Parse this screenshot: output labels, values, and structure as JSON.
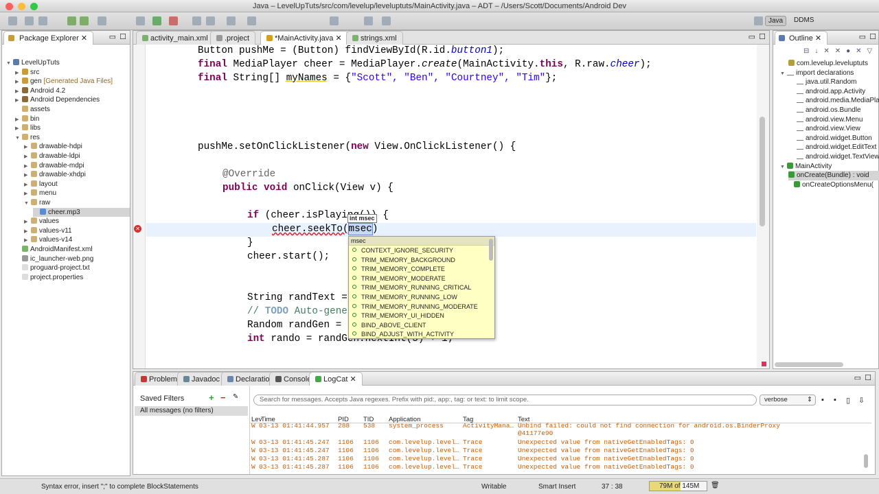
{
  "window": {
    "title": "Java – LevelUpTuts/src/com/levelup/leveluptuts/MainActivity.java – ADT – /Users/Scott/Documents/Android Dev"
  },
  "perspectives": {
    "java": "Java",
    "ddms": "DDMS"
  },
  "package_explorer": {
    "title": "Package Explorer",
    "items": [
      {
        "label": "LevelUpTuts"
      },
      {
        "label": "src"
      },
      {
        "label": "gen",
        "suffix": "[Generated Java Files]"
      },
      {
        "label": "Android 4.2"
      },
      {
        "label": "Android Dependencies"
      },
      {
        "label": "assets"
      },
      {
        "label": "bin"
      },
      {
        "label": "libs"
      },
      {
        "label": "res"
      },
      {
        "label": "drawable-hdpi"
      },
      {
        "label": "drawable-ldpi"
      },
      {
        "label": "drawable-mdpi"
      },
      {
        "label": "drawable-xhdpi"
      },
      {
        "label": "layout"
      },
      {
        "label": "menu"
      },
      {
        "label": "raw"
      },
      {
        "label": "cheer.mp3"
      },
      {
        "label": "values"
      },
      {
        "label": "values-v11"
      },
      {
        "label": "values-v14"
      },
      {
        "label": "AndroidManifest.xml"
      },
      {
        "label": "ic_launcher-web.png"
      },
      {
        "label": "proguard-project.txt"
      },
      {
        "label": "project.properties"
      }
    ]
  },
  "editor": {
    "tabs": [
      {
        "label": "activity_main.xml"
      },
      {
        "label": ".project"
      },
      {
        "label": "*MainActivity.java"
      },
      {
        "label": "strings.xml"
      }
    ],
    "code": {
      "l1a": "Button pushMe = (Button) findViewById(R.id.",
      "l1b": "button1",
      "l1c": ");",
      "l2a": "final",
      "l2b": " MediaPlayer cheer = MediaPlayer.",
      "l2c": "create",
      "l2d": "(MainActivity.",
      "l2e": "this",
      "l2f": ", R.raw.",
      "l2g": "cheer",
      "l2h": ");",
      "l3a": "final",
      "l3b": " String[] ",
      "l3c": "myNames",
      "l3d": " = {",
      "l3e": "\"Scott\", \"Ben\", \"Courtney\", \"Tim\"",
      "l3f": "};",
      "l4a": "pushMe.setOnClickListener(",
      "l4b": "new",
      "l4c": " View.OnClickListener() {",
      "l5": "@Override",
      "l6a": "public void",
      "l6b": " onClick(View v) {",
      "l7a": "if",
      "l7b": " (cheer.isPlaying()) {",
      "l8a": "cheer.seekTo(",
      "l8b": "msec",
      "l8c": ")",
      "l9": "}",
      "l10": "cheer.start();",
      "l11": "String randText = ",
      "l12a": "// ",
      "l12b": "TODO",
      "l12c": " Auto-gene",
      "l13": "Random randGen = ",
      "l14a": "int",
      "l14b": " rando = randGen.nextInt(5) + 1;"
    },
    "param_hint": "int msec",
    "autocomplete": {
      "header": "msec",
      "items": [
        "CONTEXT_IGNORE_SECURITY",
        "TRIM_MEMORY_BACKGROUND",
        "TRIM_MEMORY_COMPLETE",
        "TRIM_MEMORY_MODERATE",
        "TRIM_MEMORY_RUNNING_CRITICAL",
        "TRIM_MEMORY_RUNNING_LOW",
        "TRIM_MEMORY_RUNNING_MODERATE",
        "TRIM_MEMORY_UI_HIDDEN",
        "BIND_ABOVE_CLIENT",
        "BIND_ADJUST_WITH_ACTIVITY"
      ]
    }
  },
  "outline": {
    "title": "Outline",
    "items": [
      {
        "label": "com.levelup.leveluptuts"
      },
      {
        "label": "import declarations"
      },
      {
        "label": "java.util.Random"
      },
      {
        "label": "android.app.Activity"
      },
      {
        "label": "android.media.MediaPla"
      },
      {
        "label": "android.os.Bundle"
      },
      {
        "label": "android.view.Menu"
      },
      {
        "label": "android.view.View"
      },
      {
        "label": "android.widget.Button"
      },
      {
        "label": "android.widget.EditText"
      },
      {
        "label": "android.widget.TextView"
      },
      {
        "label": "MainActivity"
      },
      {
        "label": "onCreate(Bundle) : void"
      },
      {
        "label": "onCreateOptionsMenu("
      }
    ]
  },
  "bottom": {
    "tabs": [
      {
        "label": "Problems"
      },
      {
        "label": "Javadoc"
      },
      {
        "label": "Declaration"
      },
      {
        "label": "Console"
      },
      {
        "label": "LogCat"
      }
    ],
    "saved_filters": "Saved Filters",
    "filter_all": "All messages (no filters)",
    "search_placeholder": "Search for messages. Accepts Java regexes. Prefix with pid:, app:, tag: or text: to limit scope.",
    "level_select": "verbose",
    "columns": [
      "Lev",
      "Time",
      "PID",
      "TID",
      "Application",
      "Tag",
      "Text"
    ],
    "rows": [
      {
        "level": "W",
        "time": "03-13 01:41:44.957",
        "pid": "288",
        "tid": "538",
        "app": "system_process",
        "tag": "ActivityMana…",
        "text": "Unbind failed: could not find connection for android.os.BinderProxy",
        "text2": "@41177e90"
      },
      {
        "level": "W",
        "time": "03-13 01:41:45.247",
        "pid": "1106",
        "tid": "1106",
        "app": "com.levelup.level…",
        "tag": "Trace",
        "text": "Unexpected value from nativeGetEnabledTags: 0"
      },
      {
        "level": "W",
        "time": "03-13 01:41:45.247",
        "pid": "1106",
        "tid": "1106",
        "app": "com.levelup.level…",
        "tag": "Trace",
        "text": "Unexpected value from nativeGetEnabledTags: 0"
      },
      {
        "level": "W",
        "time": "03-13 01:41:45.287",
        "pid": "1106",
        "tid": "1106",
        "app": "com.levelup.level…",
        "tag": "Trace",
        "text": "Unexpected value from nativeGetEnabledTags: 0"
      },
      {
        "level": "W",
        "time": "03-13 01:41:45.287",
        "pid": "1106",
        "tid": "1106",
        "app": "com.levelup.level…",
        "tag": "Trace",
        "text": "Unexpected value from nativeGetEnabledTags: 0"
      }
    ]
  },
  "status": {
    "message": "Syntax error, insert \";\" to complete BlockStatements",
    "writable": "Writable",
    "insert_mode": "Smart Insert",
    "position": "37 : 38",
    "memory": "79M of 145M",
    "memory_used_fraction": 0.545
  },
  "colors": {
    "log_warn": "#c06010",
    "keyword": "#7f0055",
    "string": "#2a00ff",
    "popup_bg": "#ffffc4"
  }
}
